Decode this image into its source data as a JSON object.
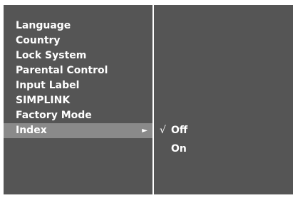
{
  "menu": {
    "items": [
      {
        "label": "Language"
      },
      {
        "label": "Country"
      },
      {
        "label": "Lock System"
      },
      {
        "label": "Parental Control"
      },
      {
        "label": "Input Label"
      },
      {
        "label": "SIMPLINK"
      },
      {
        "label": "Factory Mode"
      },
      {
        "label": "Index",
        "selected": true,
        "arrow": "►"
      }
    ]
  },
  "submenu": {
    "items": [
      {
        "label": "Off",
        "checked": true,
        "check_mark": "√"
      },
      {
        "label": "On",
        "checked": false
      }
    ]
  },
  "colors": {
    "panel_bg": "#555555",
    "selected_bg": "#8a8a8a",
    "text": "#ffffff"
  }
}
